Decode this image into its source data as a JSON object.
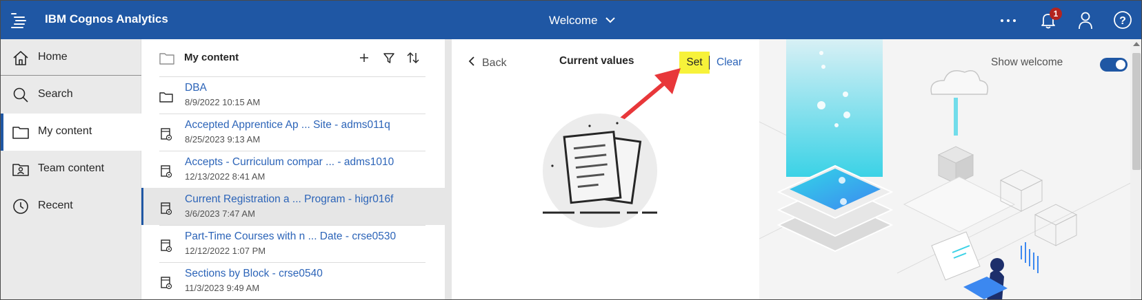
{
  "app": {
    "title": "IBM Cognos Analytics",
    "switcher_label": "Welcome",
    "notification_count": "1",
    "icons": [
      "menu-icon",
      "chevron-down-icon",
      "overflow-menu-icon",
      "notification-icon",
      "user-icon",
      "help-icon"
    ],
    "brand_color": "#1f57a4"
  },
  "sidebar": {
    "items": [
      {
        "label": "Home",
        "icon": "home-icon"
      },
      {
        "label": "Search",
        "icon": "search-icon"
      },
      {
        "label": "My content",
        "icon": "folder-icon",
        "active": true
      },
      {
        "label": "Team content",
        "icon": "team-folder-icon"
      },
      {
        "label": "Recent",
        "icon": "clock-icon"
      }
    ]
  },
  "content": {
    "title": "My content",
    "items": [
      {
        "name": "DBA",
        "date": "8/9/2022 10:15 AM",
        "type": "folder"
      },
      {
        "name": "Accepted Apprentice Ap ... Site - adms011q",
        "date": "8/25/2023 9:13 AM",
        "type": "report"
      },
      {
        "name": "Accepts - Curriculum compar ... - adms1010",
        "date": "12/13/2022 8:41 AM",
        "type": "report"
      },
      {
        "name": "Current Registration a ... Program - higr016f",
        "date": "3/6/2023 7:47 AM",
        "type": "report",
        "selected": true
      },
      {
        "name": "Part-Time Courses with n ... Date - crse0530",
        "date": "12/12/2022 1:07 PM",
        "type": "report"
      },
      {
        "name": "Sections by Block - crse0540",
        "date": "11/3/2023 9:49 AM",
        "type": "report"
      }
    ]
  },
  "values_panel": {
    "back_label": "Back",
    "title": "Current values",
    "set_label": "Set",
    "clear_label": "Clear",
    "highlight_color": "#f7f23a",
    "annotation_arrow_color": "#e8373a"
  },
  "welcome": {
    "show_welcome_label": "Show welcome",
    "toggle_on": true
  }
}
